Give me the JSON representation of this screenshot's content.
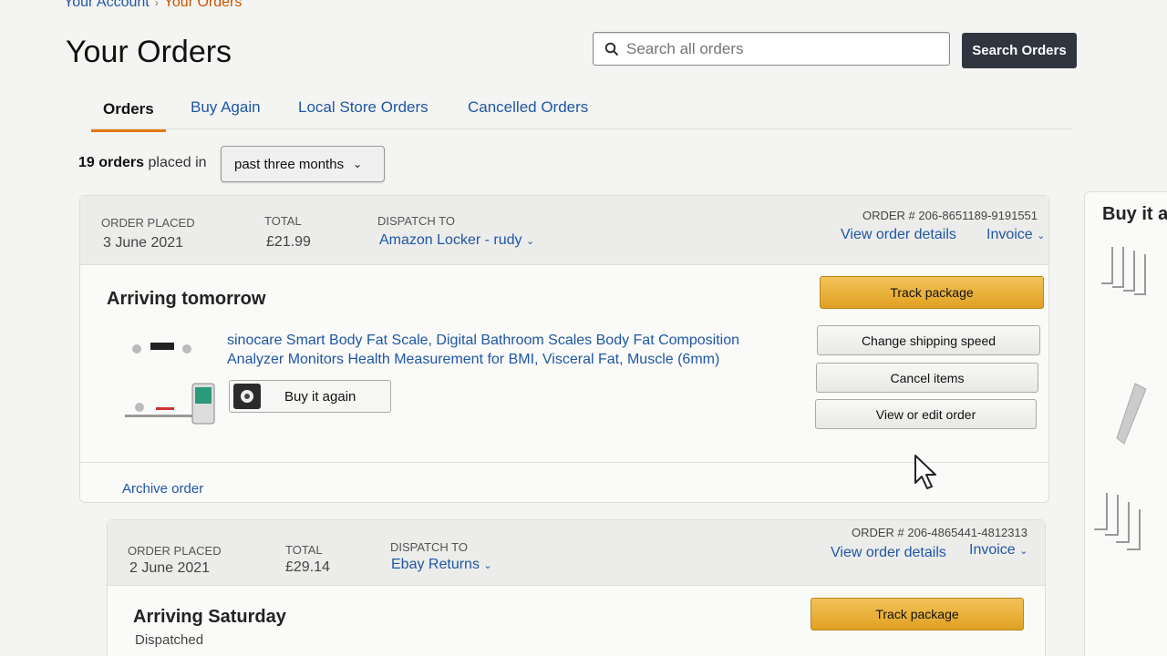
{
  "breadcrumb": {
    "parent": "Your Account",
    "current": "Your Orders"
  },
  "page_title": "Your Orders",
  "search": {
    "placeholder": "Search all orders",
    "button_label": "Search Orders"
  },
  "tabs": [
    {
      "label": "Orders",
      "active": true
    },
    {
      "label": "Buy Again"
    },
    {
      "label": "Local Store Orders"
    },
    {
      "label": "Cancelled Orders"
    }
  ],
  "filter": {
    "count_text": "19 orders",
    "suffix": "placed in",
    "period": "past three months"
  },
  "labels": {
    "order_placed": "ORDER PLACED",
    "total": "TOTAL",
    "dispatch_to": "DISPATCH TO",
    "view_order_details": "View order details",
    "invoice": "Invoice",
    "buy_it_again": "Buy it again",
    "archive_order": "Archive order"
  },
  "orders": [
    {
      "order_number": "ORDER # 206-8651189-9191551",
      "date": "3 June 2021",
      "total": "£21.99",
      "dispatch_to": "Amazon Locker - rudy",
      "status": "Arriving tomorrow",
      "product": "sinocare Smart Body Fat Scale, Digital Bathroom Scales Body Fat Composition Analyzer Monitors Health Measurement for BMI, Visceral Fat, Muscle (6mm)",
      "actions": {
        "track": "Track package",
        "change_speed": "Change shipping speed",
        "cancel": "Cancel items",
        "view_edit": "View or edit order"
      }
    },
    {
      "order_number": "ORDER # 206-4865441-4812313",
      "date": "2 June 2021",
      "total": "£29.14",
      "dispatch_to": "Ebay Returns",
      "status": "Arriving Saturday",
      "sub_status": "Dispatched",
      "actions": {
        "track": "Track package"
      }
    }
  ],
  "side_panel": {
    "title": "Buy it a"
  },
  "colors": {
    "link": "#1f57a4",
    "primary_button": "#e0a121",
    "search_button": "#2f3640",
    "tab_underline": "#e47911"
  }
}
